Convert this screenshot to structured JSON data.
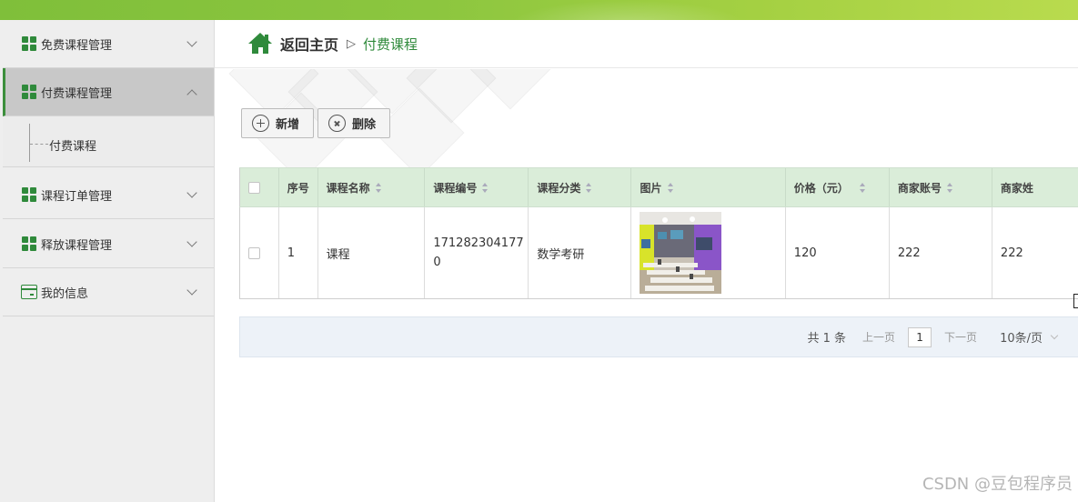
{
  "sidebar": {
    "items": [
      {
        "label": "免费课程管理",
        "icon": "grid-icon",
        "expanded": false
      },
      {
        "label": "付费课程管理",
        "icon": "grid-icon",
        "expanded": true,
        "active": true
      },
      {
        "label": "课程订单管理",
        "icon": "grid-icon",
        "expanded": false
      },
      {
        "label": "释放课程管理",
        "icon": "grid-icon",
        "expanded": false
      },
      {
        "label": "我的信息",
        "icon": "wallet-icon",
        "expanded": false
      }
    ],
    "submenu": {
      "label": "付费课程"
    }
  },
  "breadcrumb": {
    "home_label": "返回主页",
    "separator": "▷",
    "current": "付费课程"
  },
  "toolbar": {
    "add_label": "新增",
    "delete_label": "删除"
  },
  "table": {
    "columns": [
      "序号",
      "课程名称",
      "课程编号",
      "课程分类",
      "图片",
      "价格（元）",
      "商家账号",
      "商家姓"
    ],
    "rows": [
      {
        "index": "1",
        "name": "课程",
        "code": "1712823041770",
        "category": "数学考研",
        "image": "classroom-photo",
        "price": "120",
        "merchant_account": "222",
        "merchant_name": "222"
      }
    ]
  },
  "pager": {
    "total": "共 1 条",
    "prev": "上一页",
    "page": "1",
    "next": "下一页",
    "size": "10条/页"
  },
  "watermark": "CSDN @豆包程序员",
  "colors": {
    "accent": "#2f8a3b",
    "header_bg": "#daedd9",
    "topbar": "#8cc63f"
  }
}
